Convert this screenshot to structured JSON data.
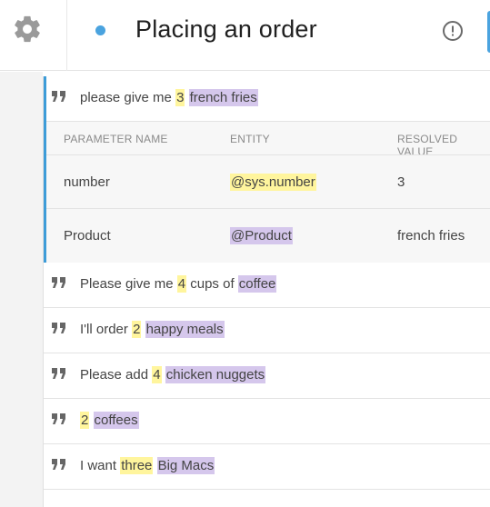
{
  "header": {
    "title": "Placing an order",
    "settings_icon": "gear-icon",
    "status_icon": "dot-icon",
    "alert_icon": "exclamation-circle-icon",
    "accent": "#4aa3df"
  },
  "active_phrase": {
    "segments": [
      {
        "text": "please give me ",
        "hl": ""
      },
      {
        "text": "3",
        "hl": "y"
      },
      {
        "text": " ",
        "hl": ""
      },
      {
        "text": "french fries",
        "hl": "p"
      }
    ],
    "table": {
      "headers": [
        "PARAMETER NAME",
        "ENTITY",
        "RESOLVED VALUE"
      ],
      "rows": [
        {
          "name": "number",
          "entity": "@sys.number",
          "entity_hl": "y",
          "value": "3"
        },
        {
          "name": "Product",
          "entity": "@Product",
          "entity_hl": "p",
          "value": "french fries"
        }
      ]
    }
  },
  "phrases": [
    [
      {
        "text": "Please give me ",
        "hl": ""
      },
      {
        "text": "4",
        "hl": "y"
      },
      {
        "text": " cups of ",
        "hl": ""
      },
      {
        "text": "coffee",
        "hl": "p"
      }
    ],
    [
      {
        "text": "I'll order ",
        "hl": ""
      },
      {
        "text": "2",
        "hl": "y"
      },
      {
        "text": " ",
        "hl": ""
      },
      {
        "text": "happy meals",
        "hl": "p"
      }
    ],
    [
      {
        "text": "Please add ",
        "hl": ""
      },
      {
        "text": "4",
        "hl": "y"
      },
      {
        "text": " ",
        "hl": ""
      },
      {
        "text": "chicken nuggets",
        "hl": "p"
      }
    ],
    [
      {
        "text": "2",
        "hl": "y"
      },
      {
        "text": " ",
        "hl": ""
      },
      {
        "text": "coffees",
        "hl": "p"
      }
    ],
    [
      {
        "text": "I want ",
        "hl": ""
      },
      {
        "text": "three",
        "hl": "y"
      },
      {
        "text": " ",
        "hl": ""
      },
      {
        "text": "Big Macs",
        "hl": "p"
      }
    ]
  ],
  "colors": {
    "highlight_number": "#fff59d",
    "highlight_entity": "#d5c7ec",
    "active_border": "#3d9cd8"
  }
}
